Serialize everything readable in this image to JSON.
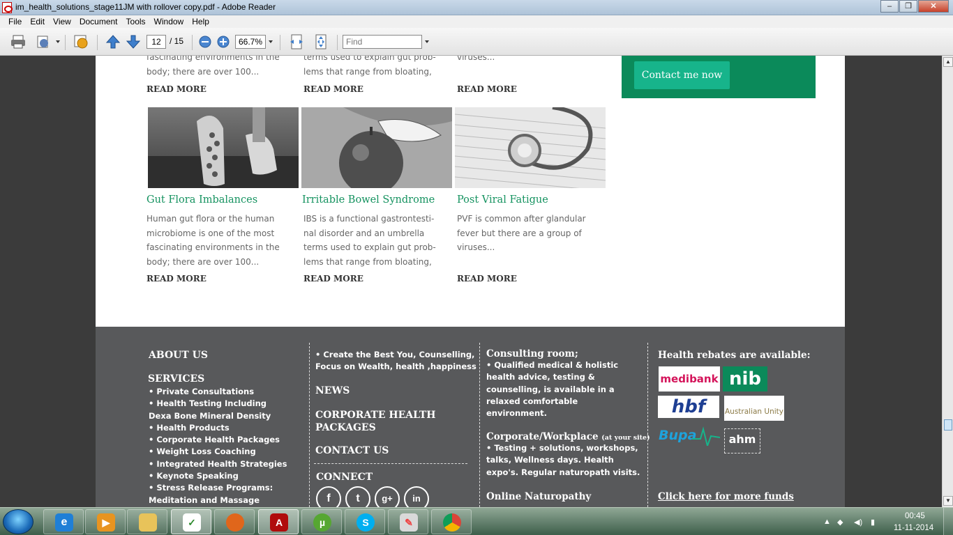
{
  "window": {
    "title": "im_health_solutions_stage11JM with rollover copy.pdf - Adobe Reader",
    "minimize": "–",
    "maximize": "❐",
    "close": "✕"
  },
  "menu": [
    "File",
    "Edit",
    "View",
    "Document",
    "Tools",
    "Window",
    "Help"
  ],
  "toolbar": {
    "page_current": "12",
    "page_total": "/ 15",
    "zoom": "66.7%",
    "find_placeholder": "Find"
  },
  "page": {
    "contact_button": "Contact me now",
    "top_row": [
      {
        "text": "fascinating environments in the\nbody; there are over 100...",
        "read_more": "READ MORE"
      },
      {
        "text": "terms used to explain gut prob-\nlems that range from bloating,",
        "read_more": "READ MORE"
      },
      {
        "text": "viruses...",
        "read_more": "READ MORE"
      }
    ],
    "cards": [
      {
        "title": "Gut Flora Imbalances",
        "text": "Human gut flora or the human\nmicrobiome is one of the most\nfascinating environments in the\nbody; there are over 100...",
        "read_more": "READ MORE",
        "image": "running-shoes-photo"
      },
      {
        "title": "Irritable Bowel Syndrome",
        "text": "IBS is a functional gastrontesti-\nnal disorder and an umbrella\nterms used to explain gut prob-\nlems that range from bloating,",
        "read_more": "READ MORE",
        "image": "woman-biting-apple-photo"
      },
      {
        "title": "Post Viral Fatigue",
        "text": "PVF is common after glandular\nfever but there are a group of\nviruses...",
        "read_more": "READ MORE",
        "image": "stethoscope-photo"
      }
    ]
  },
  "footer": {
    "about_us": "ABOUT US",
    "services": "SERVICES",
    "services_list": "• Private Consultations\n• Health Testing Including\n   Dexa Bone Mineral Density\n• Health Products\n• Corporate Health Packages\n• Weight Loss Coaching\n• Integrated Health Strategies\n• Keynote Speaking\n• Stress Release Programs:\n   Meditation and Massage",
    "col2_list": "• Create the Best You, Counselling,\n   Focus on Wealth, health ,happiness",
    "news": "NEWS",
    "corporate": "CORPORATE HEALTH\nPACKAGES",
    "contact_us": "CONTACT US",
    "connect": "CONNECT",
    "social": [
      "f",
      "t",
      "g+",
      "in"
    ],
    "consulting_head": "Consulting room;",
    "consulting_list": "• Qualified medical & holistic\n   health advice, testing &\n   counselling, is available in a\n   relaxed comfortable\n   environment.",
    "corporate_head": "Corporate/Workplace",
    "corporate_sub": "(at your site)",
    "corporate_list": "• Testing + solutions, workshops,\n   talks, Wellness days. Health\n   expo's. Regular naturopath visits.",
    "online": "Online Naturopathy",
    "rebates_head": "Health rebates are available:",
    "funds": [
      "medibank",
      "nib",
      "hbf",
      "Australian Unity",
      "Bupa",
      "ahm"
    ],
    "funds_link": "Click here for more funds"
  },
  "taskbar": {
    "apps": [
      "Internet Explorer",
      "Windows Media Player",
      "Windows Explorer",
      "Task app",
      "Firefox",
      "Adobe Reader",
      "uTorrent",
      "Skype",
      "Paint",
      "Chrome"
    ],
    "time": "00:45",
    "date": "11-11-2014"
  },
  "colors": {
    "accent_green": "#0b8a5a",
    "button_green": "#17b48b",
    "title_green": "#14925f",
    "footer_gray": "#58595b"
  }
}
